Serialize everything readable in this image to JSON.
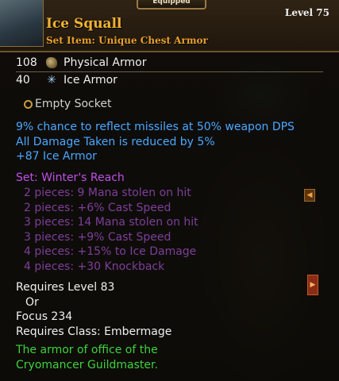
{
  "header": {
    "equipped_label": "Equipped",
    "item_name": "Ice Squall",
    "item_type": "Set Item: Unique Chest Armor",
    "level": "Level 75"
  },
  "stats": [
    {
      "value": "108",
      "label": "Physical Armor",
      "icon": "armor-icon"
    },
    {
      "value": "40",
      "label": "Ice Armor",
      "icon": "ice-snowflake-icon"
    }
  ],
  "socket": {
    "label": "Empty Socket"
  },
  "enchants": [
    "9% chance to reflect missiles at 50% weapon DPS",
    "All Damage Taken is reduced by 5%",
    "+87 Ice Armor"
  ],
  "set": {
    "title": "Set: Winter's Reach",
    "bonuses": [
      "2 pieces: 9 Mana stolen on hit",
      "2 pieces: +6% Cast Speed",
      "3 pieces: 14 Mana stolen on hit",
      "3 pieces: +9% Cast Speed",
      "4 pieces: +15% to Ice Damage",
      "4 pieces: +30 Knockback"
    ]
  },
  "requirements": {
    "level": "Requires Level 83",
    "or": "Or",
    "focus": "Focus 234",
    "class": "Requires Class: Embermage"
  },
  "flavor": [
    "The armor of office of the",
    "Cryomancer Guildmaster."
  ],
  "colors": {
    "title": "#f2b233",
    "enchant": "#4aa8ff",
    "set_title": "#c050e8",
    "set_bonus_inactive": "#7d3f9a",
    "flavor": "#3fd23f"
  }
}
